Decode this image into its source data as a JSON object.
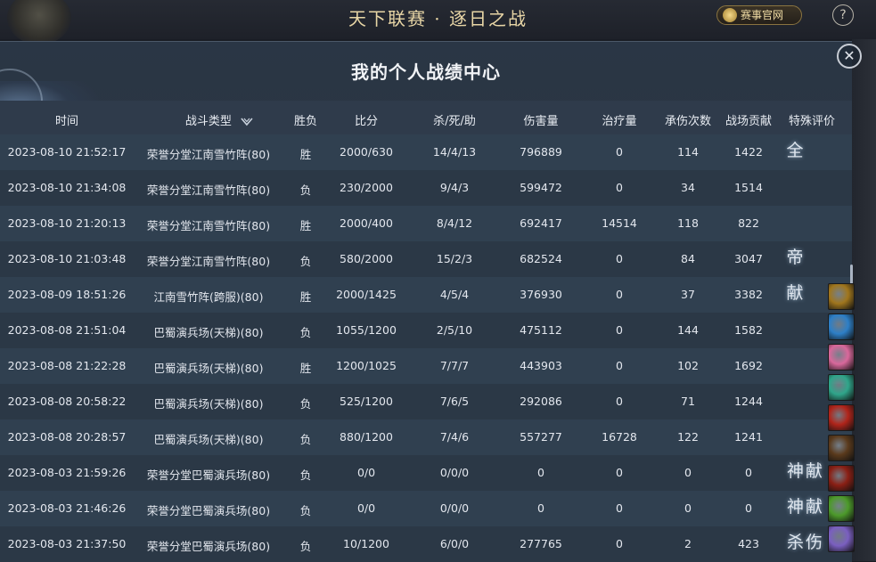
{
  "header": {
    "title": "天下联赛 · 逐日之战",
    "official_button": "赛事官网",
    "help_symbol": "?"
  },
  "panel": {
    "title": "我的个人战绩中心",
    "close_symbol": "✕"
  },
  "columns": {
    "time": "时间",
    "type": "战斗类型",
    "result": "胜负",
    "score": "比分",
    "kda": "杀/死/助",
    "damage": "伤害量",
    "heal": "治疗量",
    "hits_taken": "承伤次数",
    "contribution": "战场贡献",
    "rating": "特殊评价"
  },
  "rows": [
    {
      "time": "2023-08-10 21:52:17",
      "type": "荣誉分堂江南雪竹阵(80)",
      "result": "胜",
      "score": "2000/630",
      "kda": "14/4/13",
      "damage": "796889",
      "heal": "0",
      "hits": "114",
      "contrib": "1422",
      "badge": "全"
    },
    {
      "time": "2023-08-10 21:34:08",
      "type": "荣誉分堂江南雪竹阵(80)",
      "result": "负",
      "score": "230/2000",
      "kda": "9/4/3",
      "damage": "599472",
      "heal": "0",
      "hits": "34",
      "contrib": "1514",
      "badge": ""
    },
    {
      "time": "2023-08-10 21:20:13",
      "type": "荣誉分堂江南雪竹阵(80)",
      "result": "胜",
      "score": "2000/400",
      "kda": "8/4/12",
      "damage": "692417",
      "heal": "14514",
      "hits": "118",
      "contrib": "822",
      "badge": ""
    },
    {
      "time": "2023-08-10 21:03:48",
      "type": "荣誉分堂江南雪竹阵(80)",
      "result": "负",
      "score": "580/2000",
      "kda": "15/2/3",
      "damage": "682524",
      "heal": "0",
      "hits": "84",
      "contrib": "3047",
      "badge": "帝"
    },
    {
      "time": "2023-08-09 18:51:26",
      "type": "江南雪竹阵(跨服)(80)",
      "result": "胜",
      "score": "2000/1425",
      "kda": "4/5/4",
      "damage": "376930",
      "heal": "0",
      "hits": "37",
      "contrib": "3382",
      "badge": "献"
    },
    {
      "time": "2023-08-08 21:51:04",
      "type": "巴蜀演兵场(天梯)(80)",
      "result": "负",
      "score": "1055/1200",
      "kda": "2/5/10",
      "damage": "475112",
      "heal": "0",
      "hits": "144",
      "contrib": "1582",
      "badge": ""
    },
    {
      "time": "2023-08-08 21:22:28",
      "type": "巴蜀演兵场(天梯)(80)",
      "result": "胜",
      "score": "1200/1025",
      "kda": "7/7/7",
      "damage": "443903",
      "heal": "0",
      "hits": "102",
      "contrib": "1692",
      "badge": ""
    },
    {
      "time": "2023-08-08 20:58:22",
      "type": "巴蜀演兵场(天梯)(80)",
      "result": "负",
      "score": "525/1200",
      "kda": "7/6/5",
      "damage": "292086",
      "heal": "0",
      "hits": "71",
      "contrib": "1244",
      "badge": ""
    },
    {
      "time": "2023-08-08 20:28:57",
      "type": "巴蜀演兵场(天梯)(80)",
      "result": "负",
      "score": "880/1200",
      "kda": "7/4/6",
      "damage": "557277",
      "heal": "16728",
      "hits": "122",
      "contrib": "1241",
      "badge": ""
    },
    {
      "time": "2023-08-03 21:59:26",
      "type": "荣誉分堂巴蜀演兵场(80)",
      "result": "负",
      "score": "0/0",
      "kda": "0/0/0",
      "damage": "0",
      "heal": "0",
      "hits": "0",
      "contrib": "0",
      "badge": "神献"
    },
    {
      "time": "2023-08-03 21:46:26",
      "type": "荣誉分堂巴蜀演兵场(80)",
      "result": "负",
      "score": "0/0",
      "kda": "0/0/0",
      "damage": "0",
      "heal": "0",
      "hits": "0",
      "contrib": "0",
      "badge": "神献"
    },
    {
      "time": "2023-08-03 21:37:50",
      "type": "荣誉分堂巴蜀演兵场(80)",
      "result": "负",
      "score": "10/1200",
      "kda": "6/0/0",
      "damage": "277765",
      "heal": "0",
      "hits": "2",
      "contrib": "423",
      "badge": "杀伤"
    }
  ],
  "skill_icons": [
    {
      "name": "skill-icon-golden-beast",
      "color": "#a0761d"
    },
    {
      "name": "skill-icon-blue-vortex",
      "color": "#2d7fc7"
    },
    {
      "name": "skill-icon-pink-blossom",
      "color": "#d8689b"
    },
    {
      "name": "skill-icon-jade-ring",
      "color": "#2fa58a"
    },
    {
      "name": "skill-icon-red-fist",
      "color": "#b0241a"
    },
    {
      "name": "skill-icon-dark-blade",
      "color": "#5a3a1c"
    },
    {
      "name": "skill-icon-crossed-spears",
      "color": "#8a1f14"
    },
    {
      "name": "skill-icon-green-palm",
      "color": "#4c9a2a"
    },
    {
      "name": "skill-icon-violet-orb",
      "color": "#7a5fc0"
    }
  ],
  "colors": {
    "panel_bg": "#2b3543",
    "header_bg": "#2f3b4b",
    "row_odd": "#304050",
    "row_even": "#2b3846",
    "title_gold": "#e8d6a6"
  }
}
